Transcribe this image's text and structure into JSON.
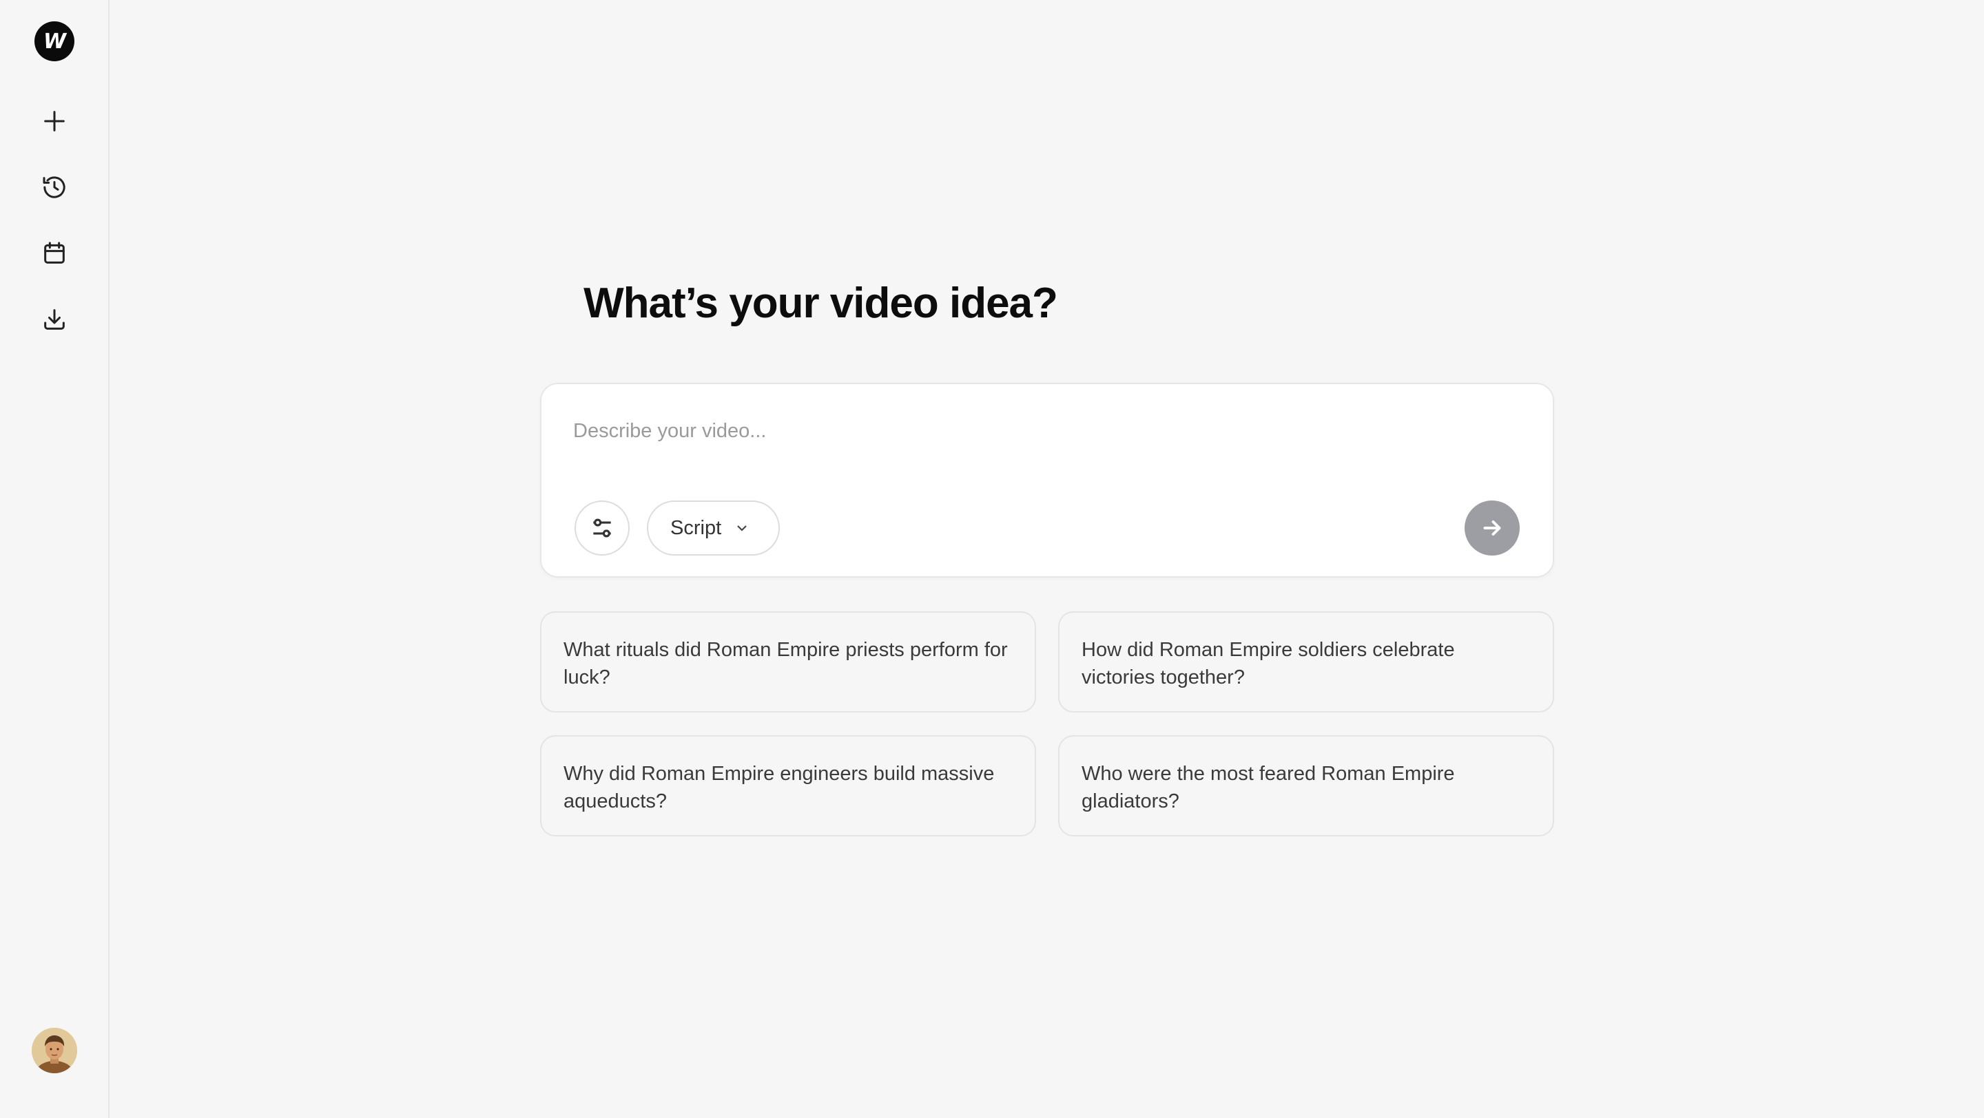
{
  "sidebar": {
    "logo_letter": "W",
    "icons": [
      "plus-icon",
      "history-icon",
      "calendar-icon",
      "download-icon"
    ]
  },
  "main": {
    "headline": "What’s your video idea?",
    "composer": {
      "placeholder": "Describe your video...",
      "value": "",
      "mode_label": "Script",
      "send_button_color": "#9d9ea4"
    },
    "suggestions": [
      "What rituals did Roman Empire priests perform for luck?",
      "How did Roman Empire soldiers celebrate victories together?",
      "Why did Roman Empire engineers build massive aqueducts?",
      "Who were the most feared Roman Empire gladiators?"
    ]
  },
  "colors": {
    "background": "#f6f6f6",
    "card": "#ffffff",
    "logo": "#0b0b0b",
    "text": "#0d0d0d"
  }
}
